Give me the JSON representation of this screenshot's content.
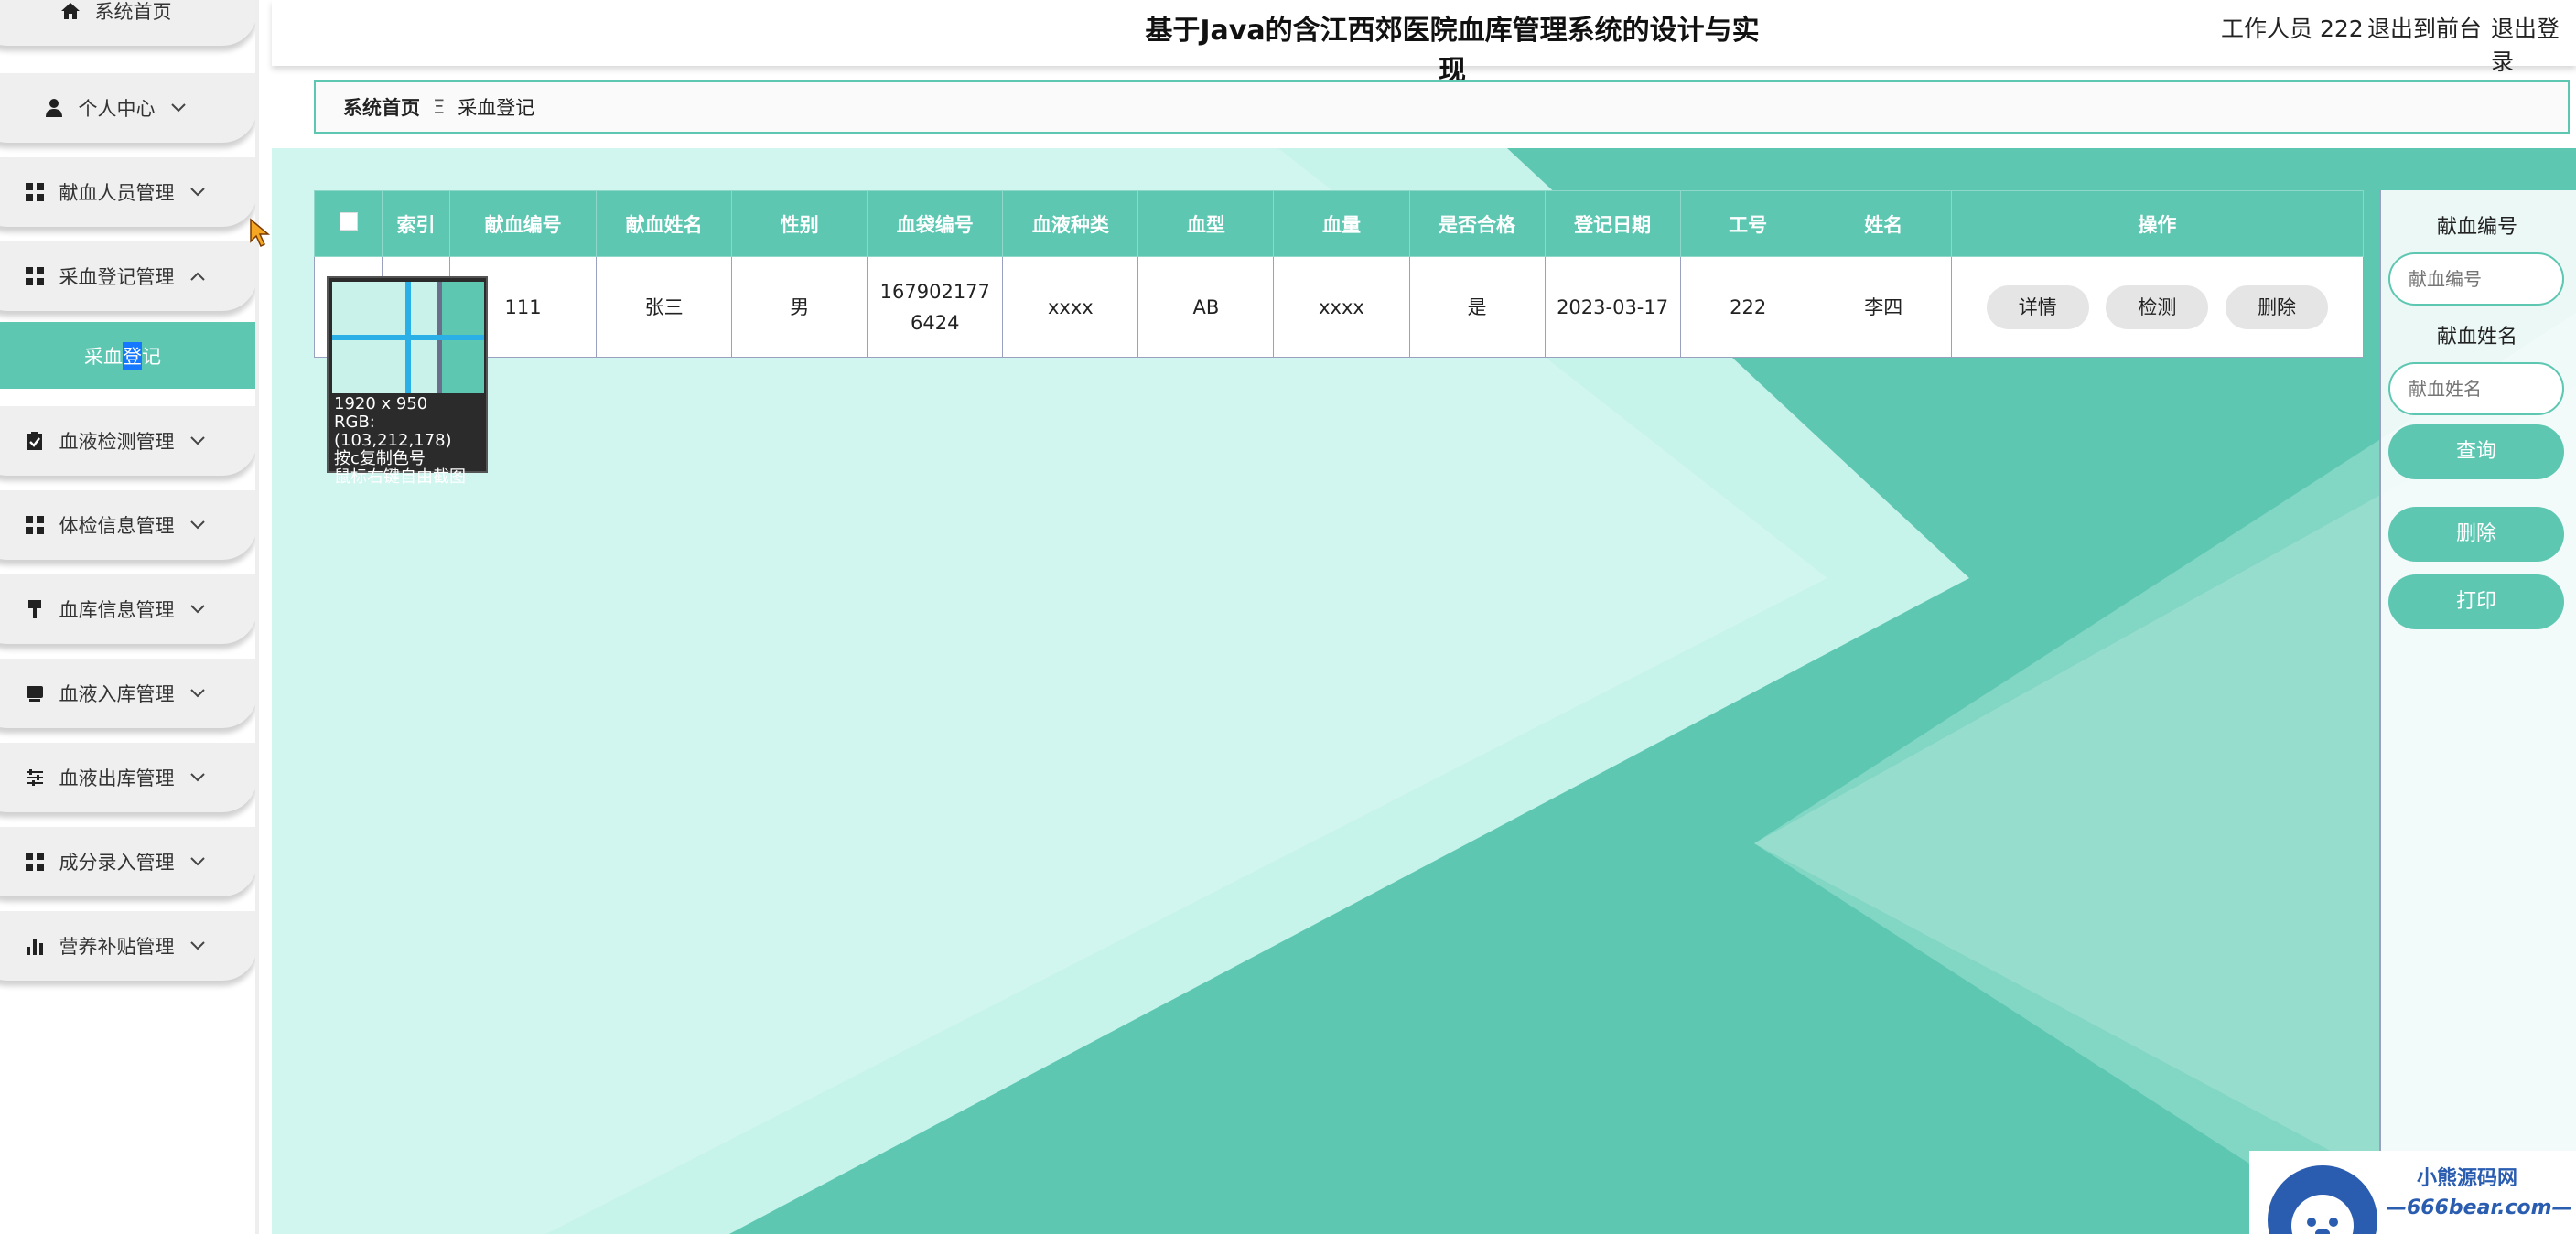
{
  "header": {
    "title": "基于Java的含江西郊医院血库管理系统的设计与实现",
    "user_label": "工作人员 222",
    "front_link": "退出到前台",
    "logout_link": "退出登录"
  },
  "sidebar": {
    "items": [
      {
        "label": "系统首页",
        "icon": "home-icon"
      },
      {
        "label": "个人中心",
        "icon": "person-icon"
      },
      {
        "label": "献血人员管理",
        "icon": "grid-icon"
      },
      {
        "label": "采血登记管理",
        "icon": "grid-icon",
        "expanded": true
      },
      {
        "label": "血液检测管理",
        "icon": "clipboard-check-icon"
      },
      {
        "label": "体检信息管理",
        "icon": "grid-icon"
      },
      {
        "label": "血库信息管理",
        "icon": "brush-icon"
      },
      {
        "label": "血液入库管理",
        "icon": "tray-icon"
      },
      {
        "label": "血液出库管理",
        "icon": "sliders-icon"
      },
      {
        "label": "成分录入管理",
        "icon": "grid-icon"
      },
      {
        "label": "营养补贴管理",
        "icon": "bar-chart-icon"
      }
    ],
    "active_sub": {
      "label_part1": "采血",
      "label_part2": "登",
      "label_part3": "记"
    }
  },
  "breadcrumb": {
    "home": "系统首页",
    "separator": "Ξ",
    "current": "采血登记"
  },
  "table": {
    "headers": [
      "索引",
      "献血编号",
      "献血姓名",
      "性别",
      "血袋编号",
      "血液种类",
      "血型",
      "血量",
      "是否合格",
      "登记日期",
      "工号",
      "姓名",
      "操作"
    ],
    "rows": [
      {
        "index": "",
        "donor_no": "111",
        "donor_name": "张三",
        "gender": "男",
        "bag_no_line1": "167902177",
        "bag_no_line2": "6424",
        "blood_kind": "xxxx",
        "blood_type": "AB",
        "volume": "xxxx",
        "qualified": "是",
        "reg_date": "2023-03-17",
        "staff_no": "222",
        "staff_name": "李四"
      }
    ],
    "actions": [
      "详情",
      "检测",
      "删除"
    ]
  },
  "picker": {
    "size": "1920 x 950",
    "rgb": "RGB:(103,212,178)",
    "hint1": "按c复制色号",
    "hint2": "鼠标右键自由截图"
  },
  "search": {
    "donor_no_label": "献血编号",
    "donor_no_placeholder": "献血编号",
    "donor_name_label": "献血姓名",
    "donor_name_placeholder": "献血姓名",
    "query_button": "查询",
    "delete_button": "删除",
    "print_button": "打印"
  },
  "watermark": {
    "top": "小熊源码网",
    "bottom": "—666bear.com—"
  },
  "colors": {
    "accent": "#5dc7b2",
    "sidebar_bg": "#efefef",
    "selected_text_bg": "#1677ff"
  }
}
